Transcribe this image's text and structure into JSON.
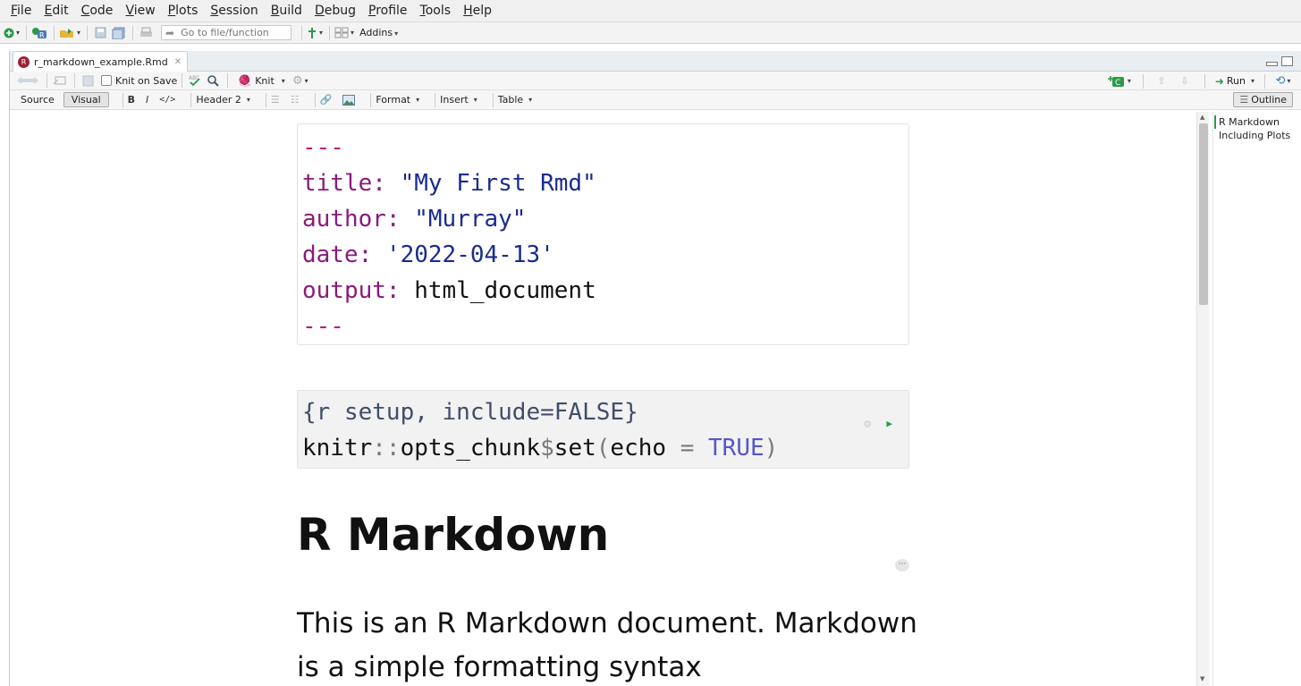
{
  "menu": [
    {
      "label": "File",
      "key": "F",
      "rest": "ile"
    },
    {
      "label": "Edit",
      "key": "E",
      "rest": "dit"
    },
    {
      "label": "Code",
      "key": "C",
      "rest": "ode"
    },
    {
      "label": "View",
      "key": "V",
      "rest": "iew"
    },
    {
      "label": "Plots",
      "key": "P",
      "rest": "lots"
    },
    {
      "label": "Session",
      "key": "S",
      "rest": "ession"
    },
    {
      "label": "Build",
      "key": "B",
      "rest": "uild"
    },
    {
      "label": "Debug",
      "key": "D",
      "rest": "ebug"
    },
    {
      "label": "Profile",
      "key": "P",
      "rest": "rofile"
    },
    {
      "label": "Tools",
      "key": "T",
      "rest": "ools"
    },
    {
      "label": "Help",
      "key": "H",
      "rest": "elp"
    }
  ],
  "toolbar": {
    "goto_placeholder": "Go to file/function",
    "addins_label": "Addins"
  },
  "tab": {
    "filename": "r_markdown_example.Rmd",
    "icon": "rmd-file-icon"
  },
  "editor_toolbar": {
    "knit_on_save_label": "Knit on Save",
    "knit_on_save_checked": false,
    "knit_label": "Knit",
    "run_label": "Run"
  },
  "format_toolbar": {
    "source_label": "Source",
    "visual_label": "Visual",
    "bold_label": "B",
    "italic_label": "I",
    "code_label": "</>",
    "heading_select": "Header 2",
    "format_label": "Format",
    "insert_label": "Insert",
    "table_label": "Table",
    "outline_label": "Outline"
  },
  "yaml": {
    "dashes": "---",
    "title_key": "title:",
    "title_value": "\"My First Rmd\"",
    "author_key": "author:",
    "author_value": "\"Murray\"",
    "date_key": "date:",
    "date_value": "'2022-04-13'",
    "output_key": "output:",
    "output_value": "html_document"
  },
  "chunk": {
    "header": "{r setup, include=FALSE}",
    "code_fn": "knitr",
    "code_ns": "::",
    "code_call": "opts_chunk",
    "code_dollar": "$",
    "code_set": "set",
    "code_open": "(",
    "code_arg": "echo",
    "code_eq": " = ",
    "code_val": "TRUE",
    "code_close": ")"
  },
  "document": {
    "heading": "R Markdown",
    "paragraph": "This is an R Markdown document. Markdown is a simple formatting syntax"
  },
  "outline": {
    "items": [
      "R Markdown",
      "Including Plots"
    ]
  },
  "colors": {
    "yaml_key": "#8b1a7a",
    "yaml_string": "#1a2c8f",
    "yaml_dash": "#c0157a",
    "chunk_bg": "#f2f2f2",
    "run_green": "#2b9a47",
    "rmd_icon": "#9b2335"
  }
}
